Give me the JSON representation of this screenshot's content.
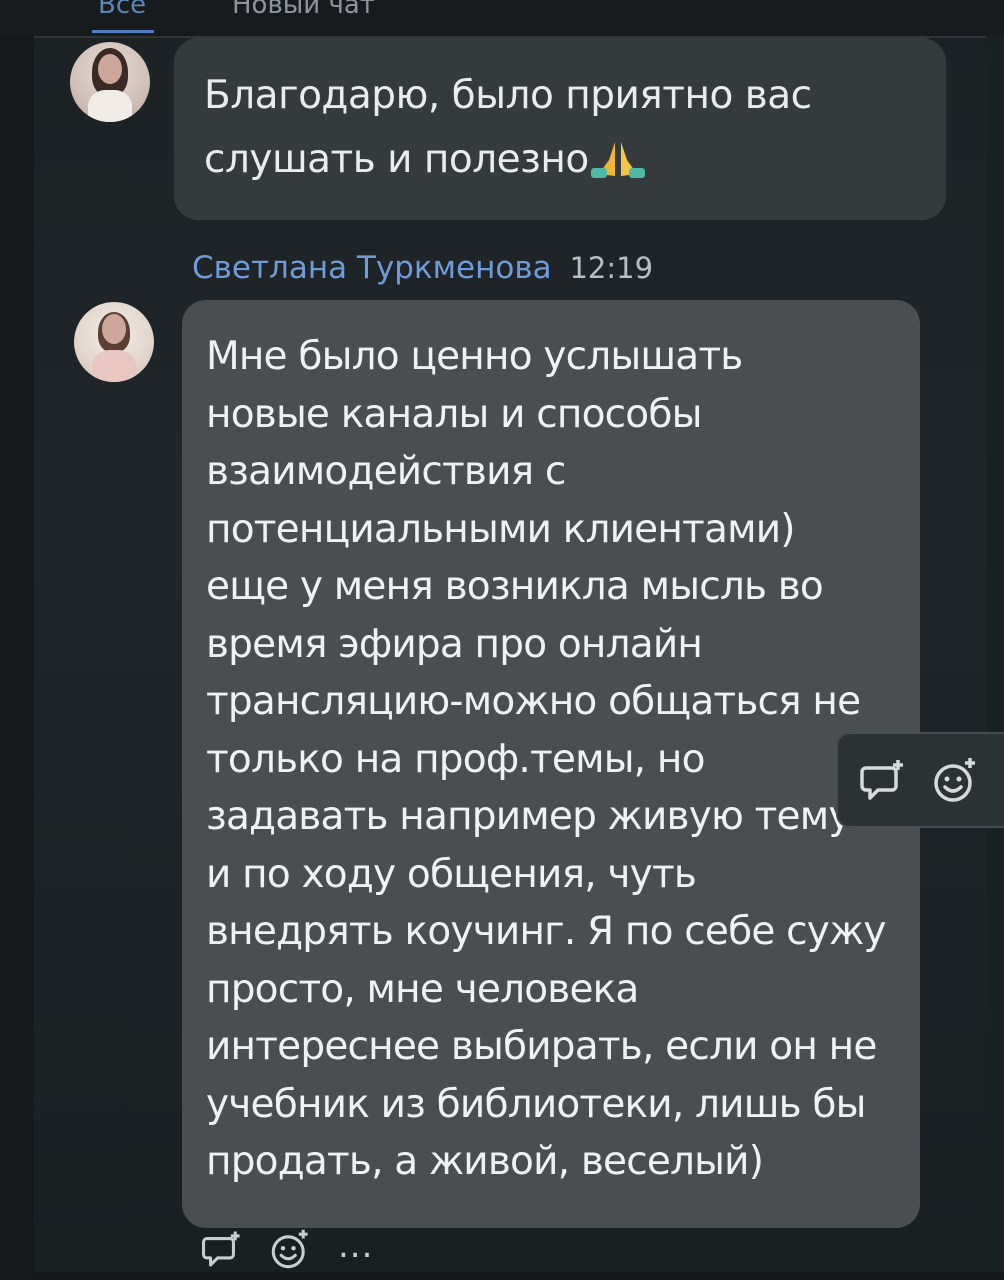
{
  "tabs": {
    "all_label": "Все",
    "new_chat_label": "Новый чат"
  },
  "messages": [
    {
      "text_line1": "Благодарю, было приятно вас",
      "text_line2": "слушать и полезно",
      "emoji": "folded-hands-emoji"
    },
    {
      "sender": "Светлана Туркменова",
      "time": "12:19",
      "text": "Мне было ценно услышать\nновые каналы и способы\nвзаимодействия с\nпотенциальными клиентами)\nеще у меня возникла мысль во\nвремя эфира про онлайн\nтрансляцию-можно общаться не\nтолько на проф.темы, но\nзадавать например живую тему\nи по ходу общения, чуть\nвнедрять коучинг. Я по себе сужу\nпросто, мне человека\nинтереснее выбирать, если он не\nучебник из библиотеки, лишь бы\nпродать, а живой, веселый)"
    }
  ],
  "actions": {
    "more_label": "...",
    "reply_icon": "reply-icon",
    "reaction_icon": "add-reaction-icon"
  },
  "colors": {
    "accent": "#6f9bd8",
    "bubble": "#4a4e51",
    "background": "#1e2326"
  }
}
